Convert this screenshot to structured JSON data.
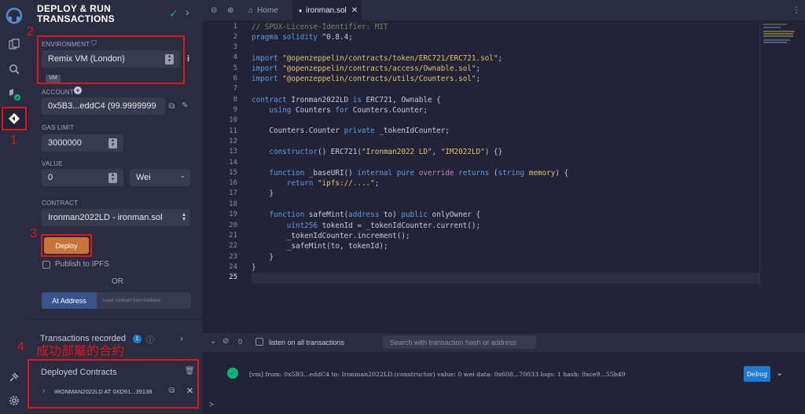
{
  "panel": {
    "title": "DEPLOY & RUN TRANSACTIONS",
    "environment_label": "ENVIRONMENT",
    "environment_value": "Remix VM (London)",
    "vm_badge": "VM",
    "account_label": "ACCOUNT",
    "account_value": "0x5B3...eddC4 (99.9999999",
    "gas_limit_label": "GAS LIMIT",
    "gas_limit_value": "3000000",
    "value_label": "VALUE",
    "value_amount": "0",
    "value_unit": "Wei",
    "contract_label": "CONTRACT",
    "contract_value": "Ironman2022LD - ironman.sol",
    "deploy_label": "Deploy",
    "publish_ipfs": "Publish to IPFS",
    "or": "OR",
    "at_address": "At Address",
    "load_placeholder": "Load contract from Address",
    "transactions_recorded": "Transactions recorded",
    "transactions_count": "1",
    "deployed_contracts": "Deployed Contracts",
    "deployed_item": "IRONMAN2022LD AT 0XD91...39138"
  },
  "annotations": {
    "n1": "1",
    "n2": "2",
    "n3": "3",
    "n4": "4",
    "success_note": "成功部屬的合約"
  },
  "tabs": {
    "home": "Home",
    "file": "ironman.sol"
  },
  "code": {
    "line_numbers": [
      "1",
      "2",
      "3",
      "4",
      "5",
      "6",
      "7",
      "8",
      "9",
      "10",
      "11",
      "12",
      "13",
      "14",
      "15",
      "16",
      "17",
      "18",
      "19",
      "20",
      "21",
      "22",
      "23",
      "24",
      "25"
    ]
  },
  "terminal": {
    "count": "0",
    "listen_label": "listen on all transactions",
    "search_placeholder": "Search with transaction hash or address",
    "log": "[vm]  from: 0x5B3...eddC4 to: Ironman2022LD.(constructor) value: 0 wei data: 0x608...70033 logs: 1 hash: 0xce9...55b49",
    "debug": "Debug",
    "prompt": ">"
  }
}
